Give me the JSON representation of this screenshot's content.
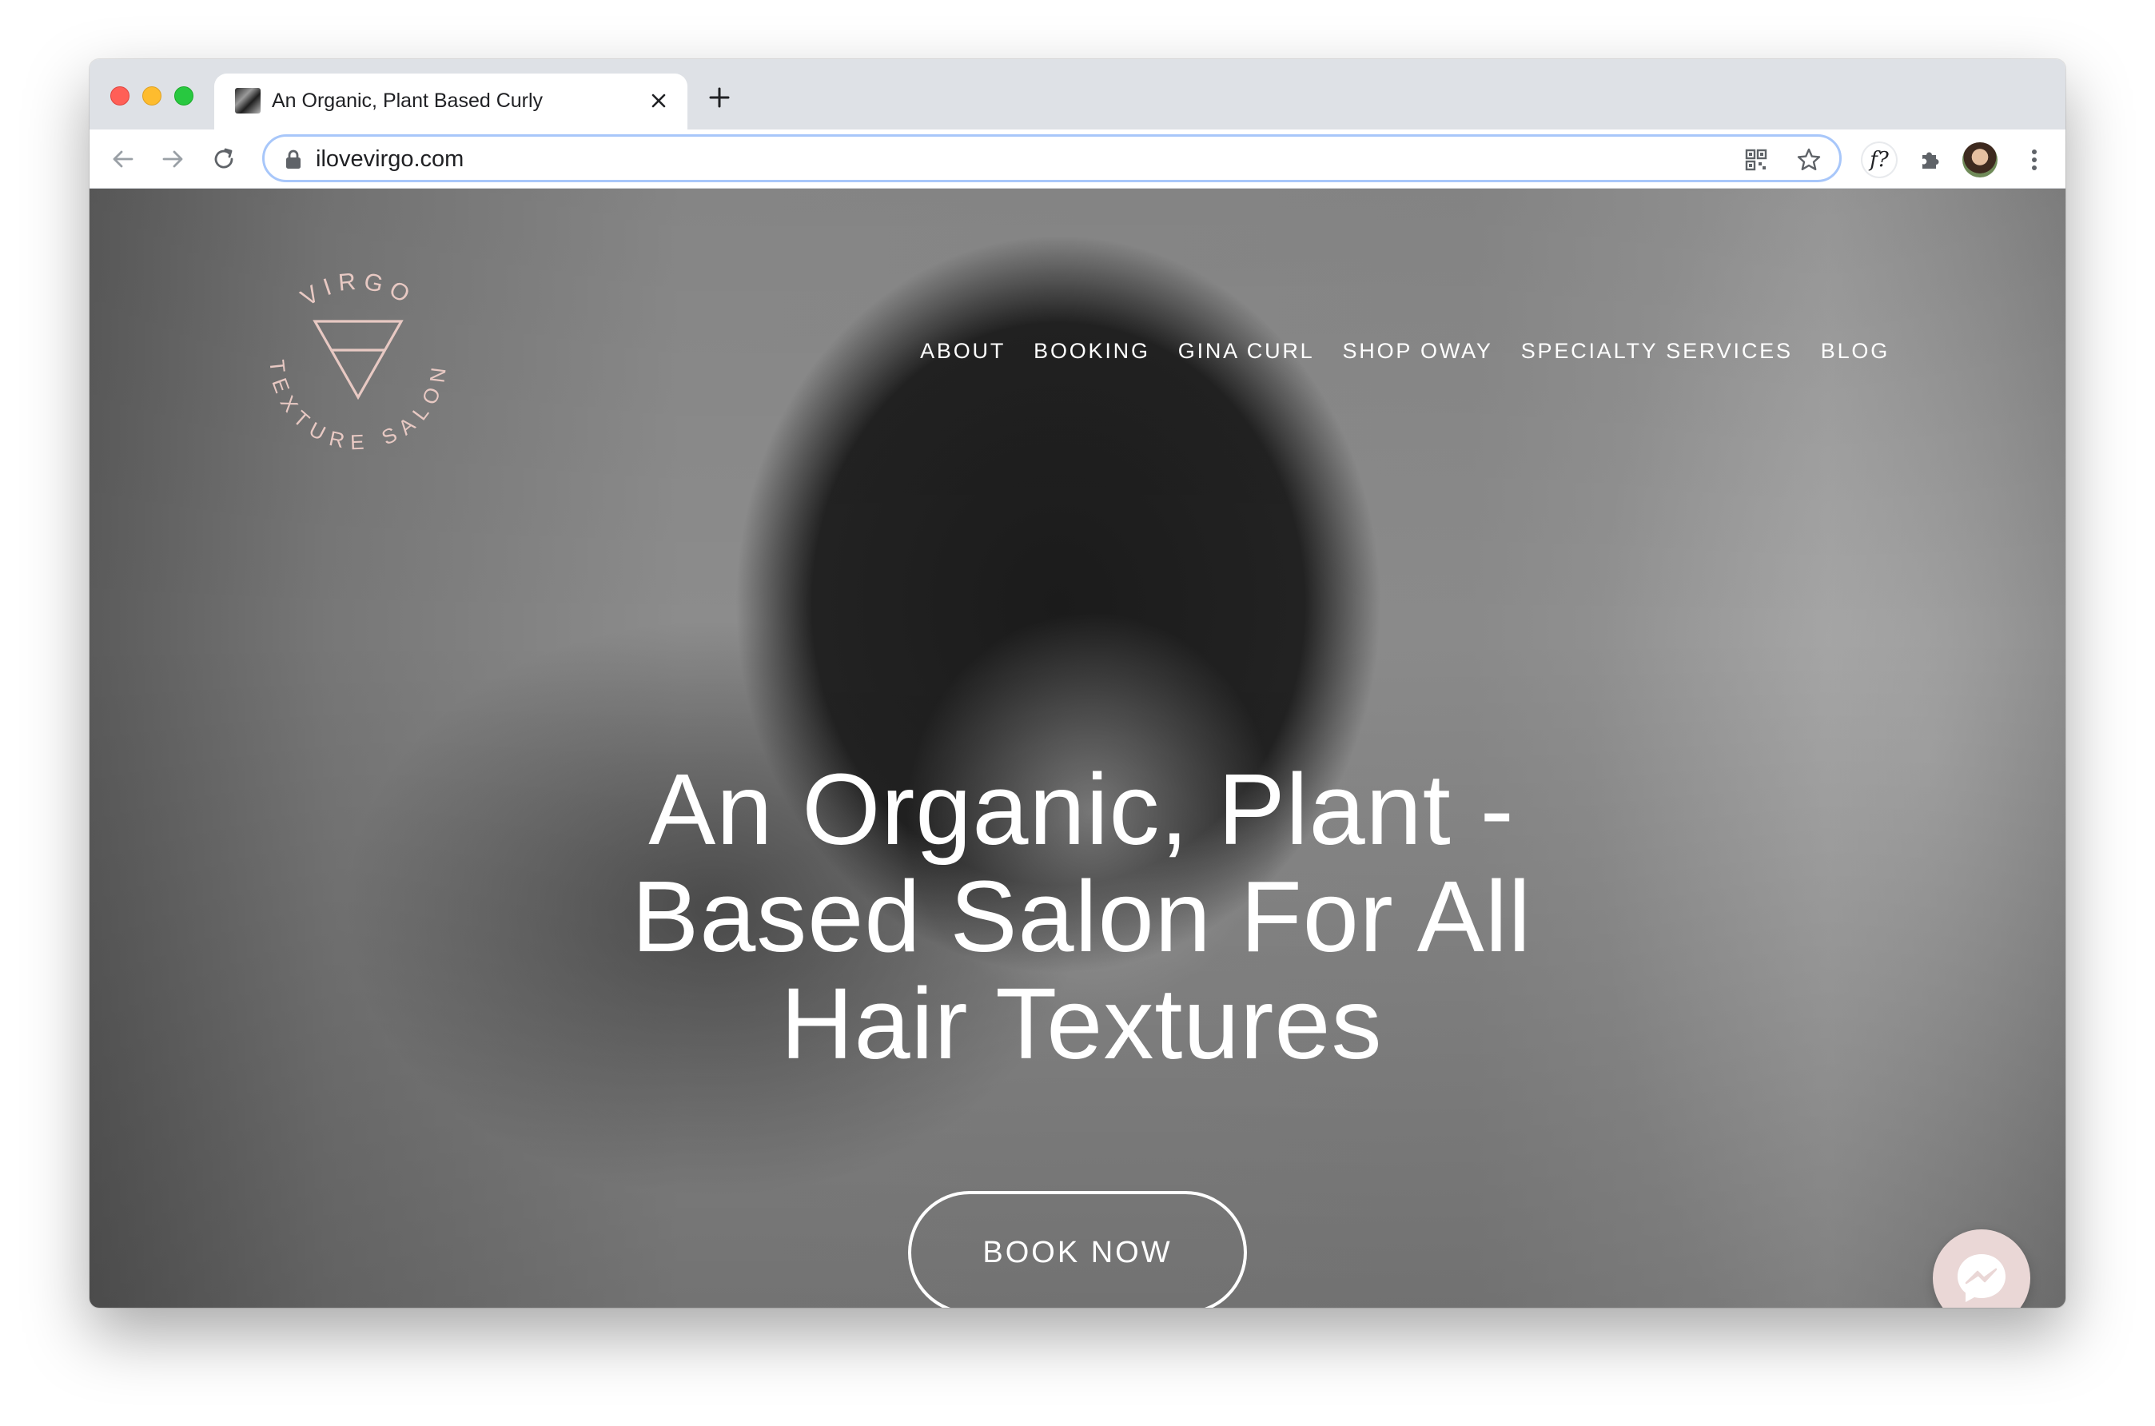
{
  "browser": {
    "tab_title": "An Organic, Plant Based Curly",
    "tab_close_icon": "close-icon",
    "new_tab_icon": "plus-icon",
    "url": "ilovevirgo.com",
    "extension_font_label": "f?"
  },
  "site": {
    "logo": {
      "name_text": "VIRGO",
      "sub_text": "TEXTURE SALON",
      "color": "#e8c9c3"
    },
    "nav": {
      "items": [
        {
          "label": "ABOUT"
        },
        {
          "label": "BOOKING"
        },
        {
          "label": "GINA CURL"
        },
        {
          "label": "SHOP OWAY"
        },
        {
          "label": "SPECIALTY SERVICES"
        },
        {
          "label": "BLOG"
        }
      ]
    },
    "hero": {
      "line1": "An Organic, Plant -",
      "line2": "Based Salon For All",
      "line3": "Hair Textures",
      "cta_label": "BOOK NOW"
    },
    "chat_widget_icon": "messenger-icon",
    "chat_widget_color": "#ead7d6"
  }
}
